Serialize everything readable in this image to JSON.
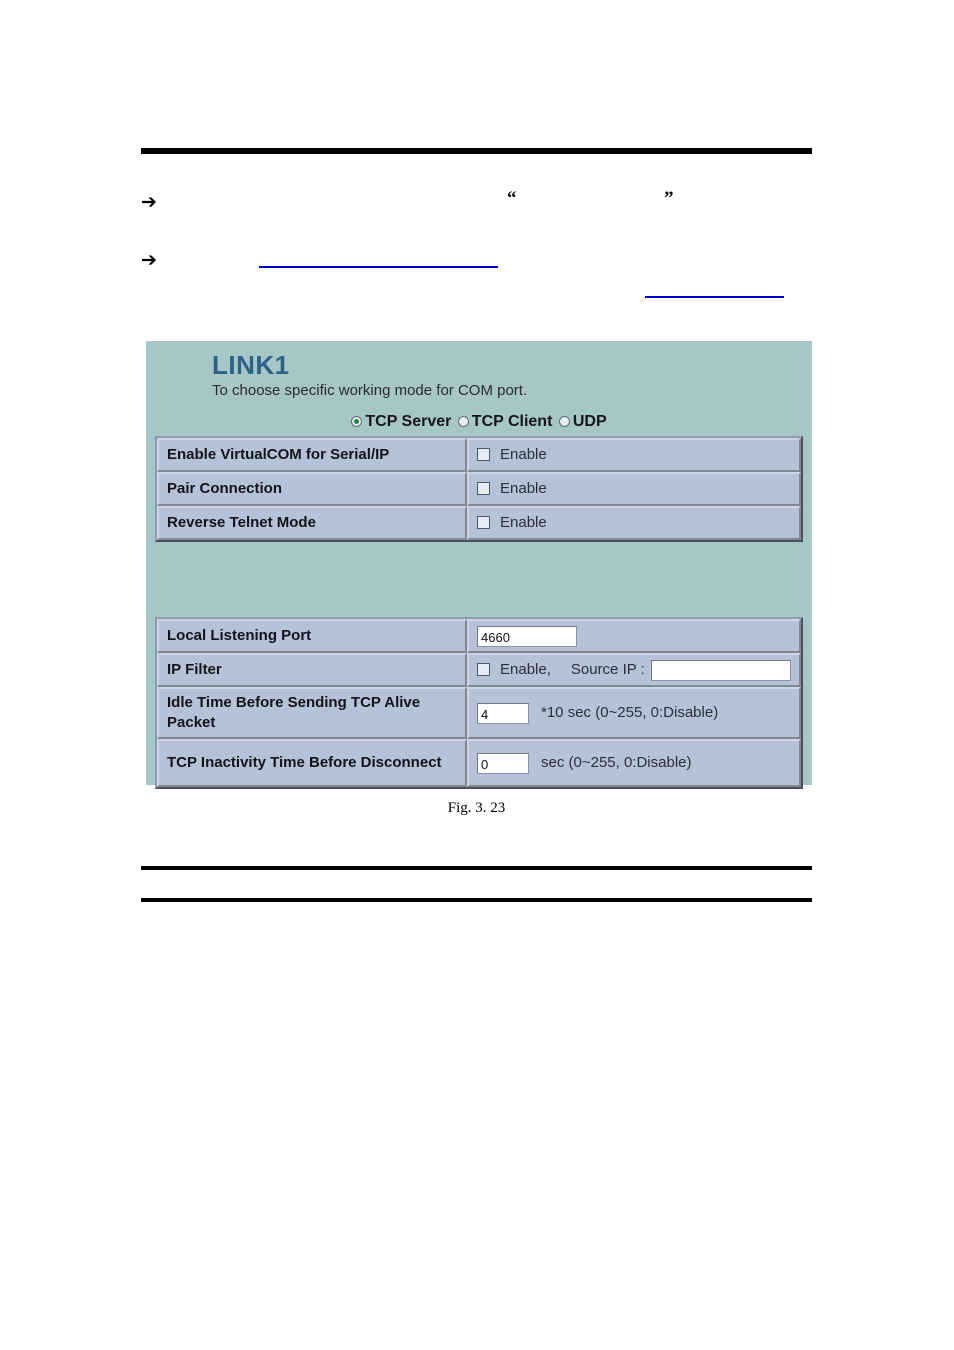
{
  "document": {
    "bullets": [
      {
        "arrow": "➔",
        "text": "",
        "quote_open": "“",
        "quote_close": "”"
      },
      {
        "arrow": "➔",
        "text": ""
      }
    ],
    "figure_caption": "Fig. 3. 23"
  },
  "panel": {
    "title": "LINK1",
    "subtitle": "To choose specific working mode for COM port.",
    "background_color": "#a7c6c7",
    "title_color": "#2c6285",
    "modes": [
      {
        "label": "TCP Server",
        "selected": true
      },
      {
        "label": "TCP Client",
        "selected": false
      },
      {
        "label": "UDP",
        "selected": false
      }
    ],
    "group_one": [
      {
        "label": "Enable VirtualCOM for Serial/IP",
        "checkbox_label": "Enable",
        "checked": false
      },
      {
        "label": "Pair Connection",
        "checkbox_label": "Enable",
        "checked": false
      },
      {
        "label": "Reverse Telnet Mode",
        "checkbox_label": "Enable",
        "checked": false
      }
    ],
    "group_two": {
      "local_port": {
        "label": "Local Listening Port",
        "value": "4660"
      },
      "ip_filter": {
        "label": "IP Filter",
        "checkbox_label": "Enable,",
        "checked": false,
        "source_ip_label": "Source IP :",
        "source_ip_value": ""
      },
      "idle_time": {
        "label": "Idle Time Before Sending TCP Alive Packet",
        "value": "4",
        "unit_note": "*10 sec (0~255, 0:Disable)"
      },
      "inactivity_time": {
        "label": "TCP Inactivity Time Before Disconnect",
        "value": "0",
        "unit_note": "sec (0~255, 0:Disable)"
      }
    }
  }
}
